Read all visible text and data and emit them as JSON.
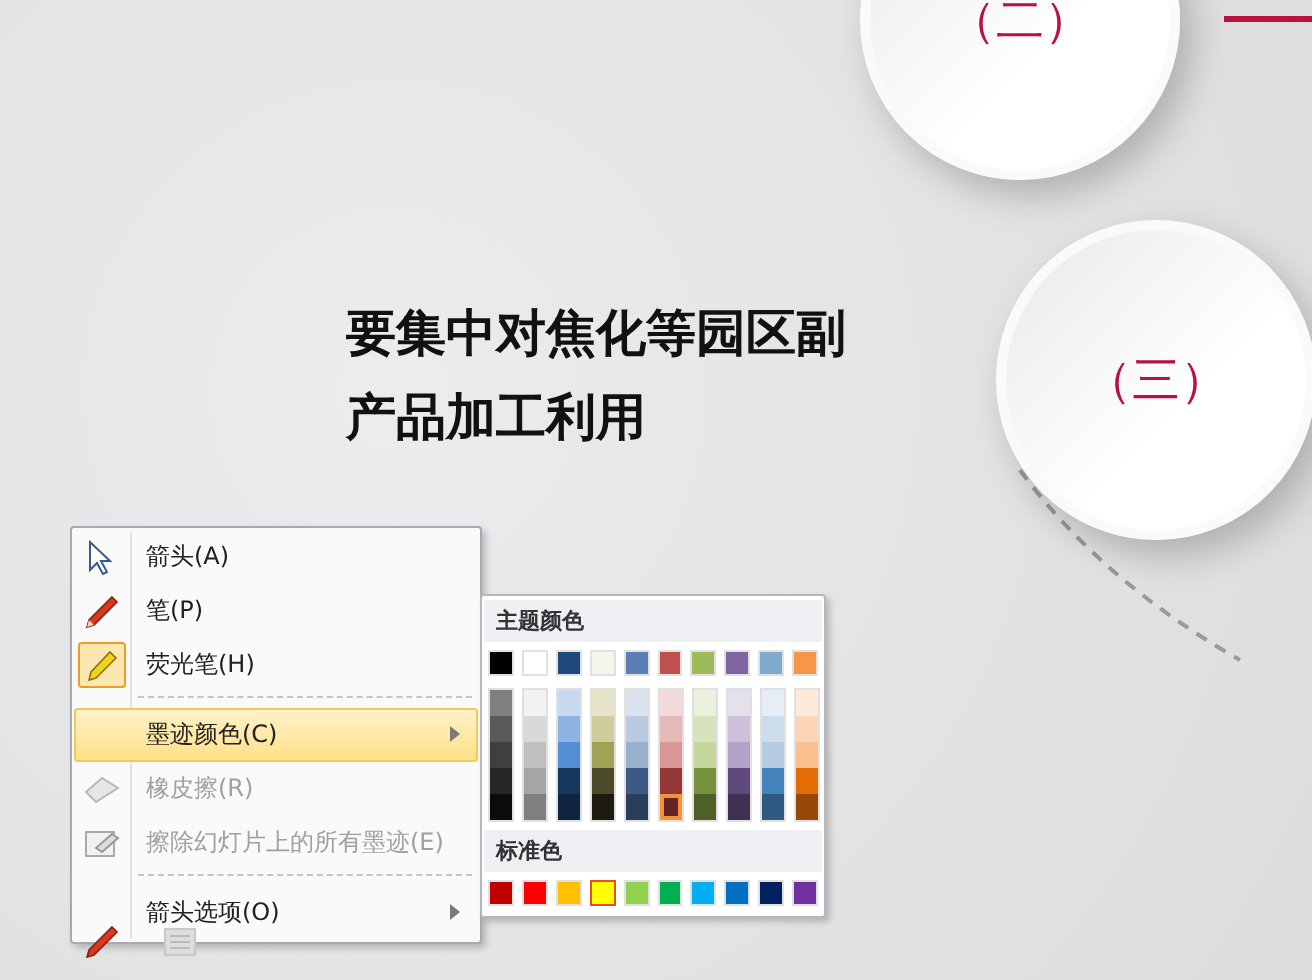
{
  "slide": {
    "title_lines": [
      "要集中对焦化等园区副",
      "产品加工利用"
    ],
    "circles": [
      {
        "label": "（二）"
      },
      {
        "label": "（三）"
      }
    ]
  },
  "context_menu": {
    "items": [
      {
        "kind": "item",
        "label": "箭头(A)",
        "checked": false,
        "disabled": false,
        "selected": false,
        "submenu": false
      },
      {
        "kind": "item",
        "label": "笔(P)",
        "checked": false,
        "disabled": false,
        "selected": false,
        "submenu": false
      },
      {
        "kind": "item",
        "label": "荧光笔(H)",
        "checked": true,
        "disabled": false,
        "selected": false,
        "submenu": false
      },
      {
        "kind": "separator"
      },
      {
        "kind": "item",
        "label": "墨迹颜色(C)",
        "checked": false,
        "disabled": false,
        "selected": true,
        "submenu": true
      },
      {
        "kind": "item",
        "label": "橡皮擦(R)",
        "checked": false,
        "disabled": true,
        "selected": false,
        "submenu": false
      },
      {
        "kind": "item",
        "label": "擦除幻灯片上的所有墨迹(E)",
        "checked": false,
        "disabled": true,
        "selected": false,
        "submenu": false
      },
      {
        "kind": "separator"
      },
      {
        "kind": "item",
        "label": "箭头选项(O)",
        "checked": false,
        "disabled": false,
        "selected": false,
        "submenu": true
      }
    ]
  },
  "color_menu": {
    "theme_title": "主题颜色",
    "theme_columns": [
      {
        "color": "#000000",
        "selected": false,
        "shades": [
          {
            "color": "#7f7f7f",
            "selected": false
          },
          {
            "color": "#595959",
            "selected": false
          },
          {
            "color": "#3f3f3f",
            "selected": false
          },
          {
            "color": "#262626",
            "selected": false
          },
          {
            "color": "#0c0c0c",
            "selected": false
          }
        ]
      },
      {
        "color": "#ffffff",
        "selected": false,
        "shades": [
          {
            "color": "#f2f2f2",
            "selected": false
          },
          {
            "color": "#d8d8d8",
            "selected": false
          },
          {
            "color": "#bfbfbf",
            "selected": false
          },
          {
            "color": "#a5a5a5",
            "selected": false
          },
          {
            "color": "#7f7f7f",
            "selected": false
          }
        ]
      },
      {
        "color": "#1f497d",
        "selected": false,
        "shades": [
          {
            "color": "#c6d9f0",
            "selected": false
          },
          {
            "color": "#8db3e2",
            "selected": false
          },
          {
            "color": "#548dd4",
            "selected": false
          },
          {
            "color": "#17365d",
            "selected": false
          },
          {
            "color": "#0f243e",
            "selected": false
          }
        ]
      },
      {
        "color": "#f5f5ee",
        "selected": false,
        "shades": [
          {
            "color": "#e6e4c8",
            "selected": false
          },
          {
            "color": "#d0cd9c",
            "selected": false
          },
          {
            "color": "#a2a255",
            "selected": false
          },
          {
            "color": "#4a4a28",
            "selected": false
          },
          {
            "color": "#1d1b10",
            "selected": false
          }
        ]
      },
      {
        "color": "#5b7fb4",
        "selected": false,
        "shades": [
          {
            "color": "#dbe3ee",
            "selected": false
          },
          {
            "color": "#b8c9e0",
            "selected": false
          },
          {
            "color": "#9ab0cf",
            "selected": false
          },
          {
            "color": "#3d5a87",
            "selected": false
          },
          {
            "color": "#283e5c",
            "selected": false
          }
        ]
      },
      {
        "color": "#c0504d",
        "selected": false,
        "shades": [
          {
            "color": "#f2dcdb",
            "selected": false
          },
          {
            "color": "#e5b9b7",
            "selected": false
          },
          {
            "color": "#d99694",
            "selected": false
          },
          {
            "color": "#953734",
            "selected": false
          },
          {
            "color": "#632423",
            "selected": true
          }
        ]
      },
      {
        "color": "#9bbb59",
        "selected": false,
        "shades": [
          {
            "color": "#ebf1dd",
            "selected": false
          },
          {
            "color": "#d7e3bc",
            "selected": false
          },
          {
            "color": "#c3d69b",
            "selected": false
          },
          {
            "color": "#76923c",
            "selected": false
          },
          {
            "color": "#4f6128",
            "selected": false
          }
        ]
      },
      {
        "color": "#8064a2",
        "selected": false,
        "shades": [
          {
            "color": "#e5e0ec",
            "selected": false
          },
          {
            "color": "#ccc1d9",
            "selected": false
          },
          {
            "color": "#b2a2c7",
            "selected": false
          },
          {
            "color": "#5f497a",
            "selected": false
          },
          {
            "color": "#3f3151",
            "selected": false
          }
        ]
      },
      {
        "color": "#7faacf",
        "selected": false,
        "shades": [
          {
            "color": "#e6edf5",
            "selected": false
          },
          {
            "color": "#cddcea",
            "selected": false
          },
          {
            "color": "#b5cbe0",
            "selected": false
          },
          {
            "color": "#4683bd",
            "selected": false
          },
          {
            "color": "#2e5a82",
            "selected": false
          }
        ]
      },
      {
        "color": "#f79646",
        "selected": false,
        "shades": [
          {
            "color": "#fdeada",
            "selected": false
          },
          {
            "color": "#fbd5b5",
            "selected": false
          },
          {
            "color": "#fac08f",
            "selected": false
          },
          {
            "color": "#e36c09",
            "selected": false
          },
          {
            "color": "#974806",
            "selected": false
          }
        ]
      }
    ],
    "standard_title": "标准色",
    "standard_colors": [
      {
        "color": "#c00000",
        "selected": false
      },
      {
        "color": "#ff0000",
        "selected": false
      },
      {
        "color": "#ffc000",
        "selected": false
      },
      {
        "color": "#ffff00",
        "selected": true
      },
      {
        "color": "#92d050",
        "selected": false
      },
      {
        "color": "#00b050",
        "selected": false
      },
      {
        "color": "#00b0f0",
        "selected": false
      },
      {
        "color": "#0070c0",
        "selected": false
      },
      {
        "color": "#002060",
        "selected": false
      },
      {
        "color": "#7030a0",
        "selected": false
      }
    ]
  }
}
